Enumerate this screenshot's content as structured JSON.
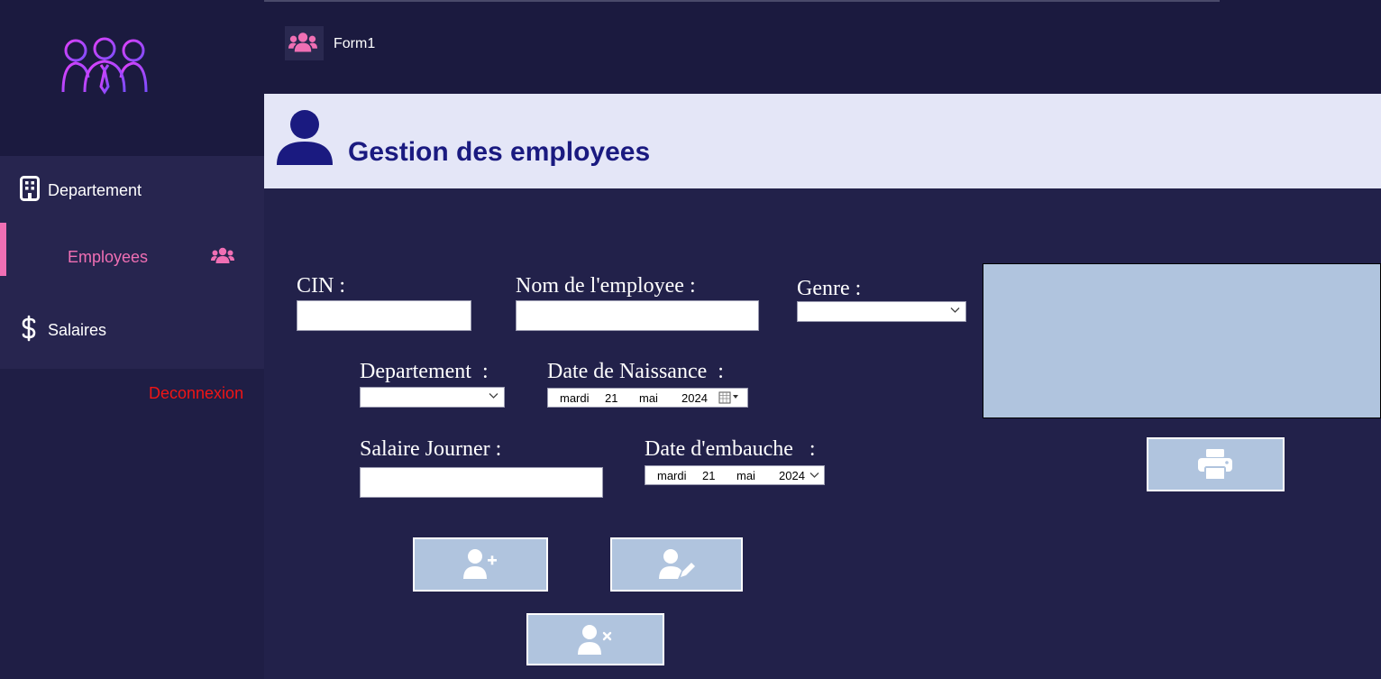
{
  "window": {
    "title": "Form1"
  },
  "sidebar": {
    "items": [
      {
        "label": "Departement",
        "icon": "building-icon"
      },
      {
        "label": "Employees",
        "icon": "users-icon",
        "active": true
      },
      {
        "label": "Salaires",
        "icon": "dollar-icon"
      }
    ],
    "logout_label": "Deconnexion"
  },
  "header": {
    "title": "Gestion des employees"
  },
  "form": {
    "cin_label": "CIN :",
    "name_label": "Nom de l'employee :",
    "genre_label": "Genre :",
    "departement_label": "Departement  :",
    "birth_label": "Date de Naissance  :",
    "salary_label": "Salaire Journer :",
    "hire_label": "Date d'embauche   :",
    "birth_date": {
      "weekday": "mardi",
      "day": "21",
      "month": "mai",
      "year": "2024"
    },
    "hire_date": {
      "weekday": "mardi",
      "day": "21",
      "month": "mai",
      "year": "2024"
    }
  },
  "colors": {
    "accent": "#f06fb4",
    "background": "#22214a",
    "header_band": "#e4e6f7",
    "button": "#b0c4de",
    "logout": "#f01515"
  }
}
